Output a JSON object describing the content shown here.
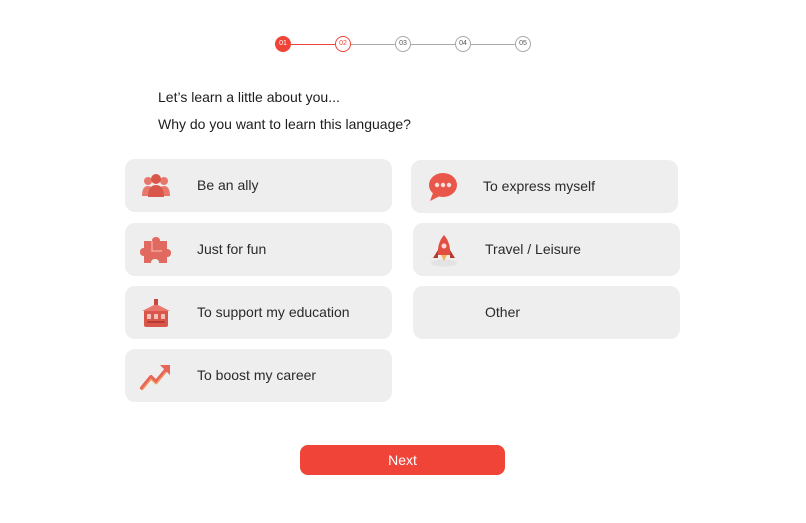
{
  "stepper": {
    "steps": [
      "01",
      "02",
      "03",
      "04",
      "05"
    ],
    "active_index": 0,
    "current_index": 1,
    "active_color": "#f04438",
    "inactive_color": "#a8a8a8"
  },
  "heading": {
    "line1": "Let’s learn a little about you...",
    "line2": "Why do you want to learn this language?"
  },
  "options": [
    {
      "label": "Be an ally",
      "icon": "people-group-icon"
    },
    {
      "label": "To express myself",
      "icon": "speech-bubble-icon"
    },
    {
      "label": "Just for fun",
      "icon": "puzzle-piece-icon"
    },
    {
      "label": "Travel / Leisure",
      "icon": "rocket-icon"
    },
    {
      "label": "To support my education",
      "icon": "school-building-icon"
    },
    {
      "label": "Other",
      "icon": ""
    },
    {
      "label": "To boost my career",
      "icon": "trending-arrow-icon"
    }
  ],
  "next_button": {
    "label": "Next"
  },
  "colors": {
    "accent": "#f04438",
    "card": "#eeeeee"
  }
}
